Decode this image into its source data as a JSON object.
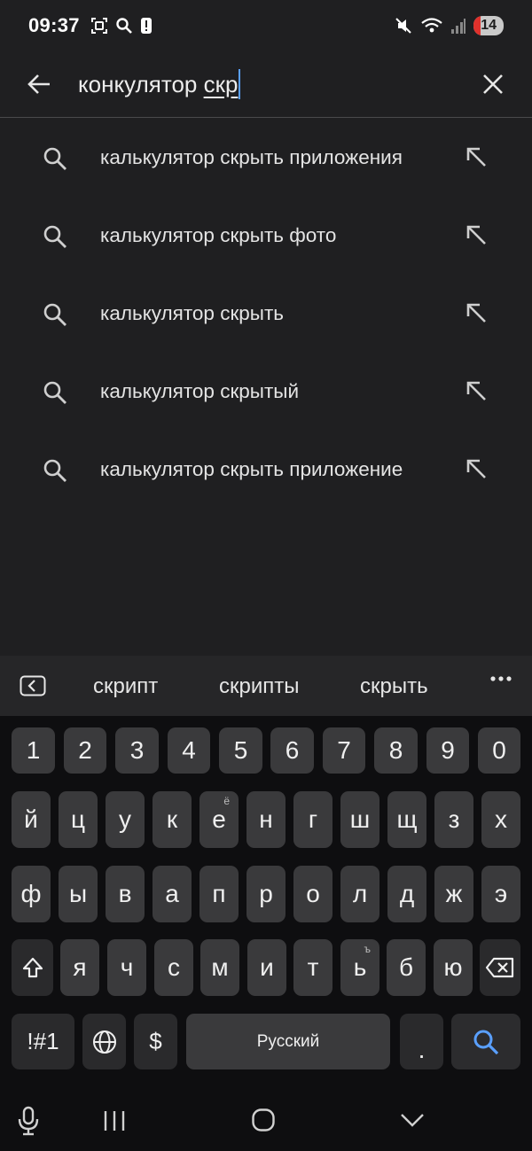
{
  "status_bar": {
    "time": "09:37",
    "battery": "14"
  },
  "search": {
    "query_prefix": "конкулятор ",
    "query_underlined": "скр"
  },
  "suggestions": [
    "калькулятор скрыть приложения",
    "калькулятор скрыть фото",
    "калькулятор скрыть",
    "калькулятор скрытый",
    "калькулятор скрыть приложение"
  ],
  "keyboard": {
    "word_suggestions": [
      "скрипт",
      "скрипты",
      "скрыть"
    ],
    "number_row": [
      "1",
      "2",
      "3",
      "4",
      "5",
      "6",
      "7",
      "8",
      "9",
      "0"
    ],
    "row1": [
      "й",
      "ц",
      "у",
      "к",
      "е",
      "н",
      "г",
      "ш",
      "щ",
      "з",
      "х"
    ],
    "row1_sup_e": "ё",
    "row2": [
      "ф",
      "ы",
      "в",
      "а",
      "п",
      "р",
      "о",
      "л",
      "д",
      "ж",
      "э"
    ],
    "row3": [
      "я",
      "ч",
      "с",
      "м",
      "и",
      "т",
      "ь",
      "б",
      "ю"
    ],
    "row3_sup_soft": "ъ",
    "symbols_label": "!#1",
    "currency_label": "$",
    "space_label": "Русский",
    "period_label": "."
  },
  "colors": {
    "background": "#1f1f21",
    "accent": "#5aa0ff",
    "battery_low": "#e0312c"
  }
}
